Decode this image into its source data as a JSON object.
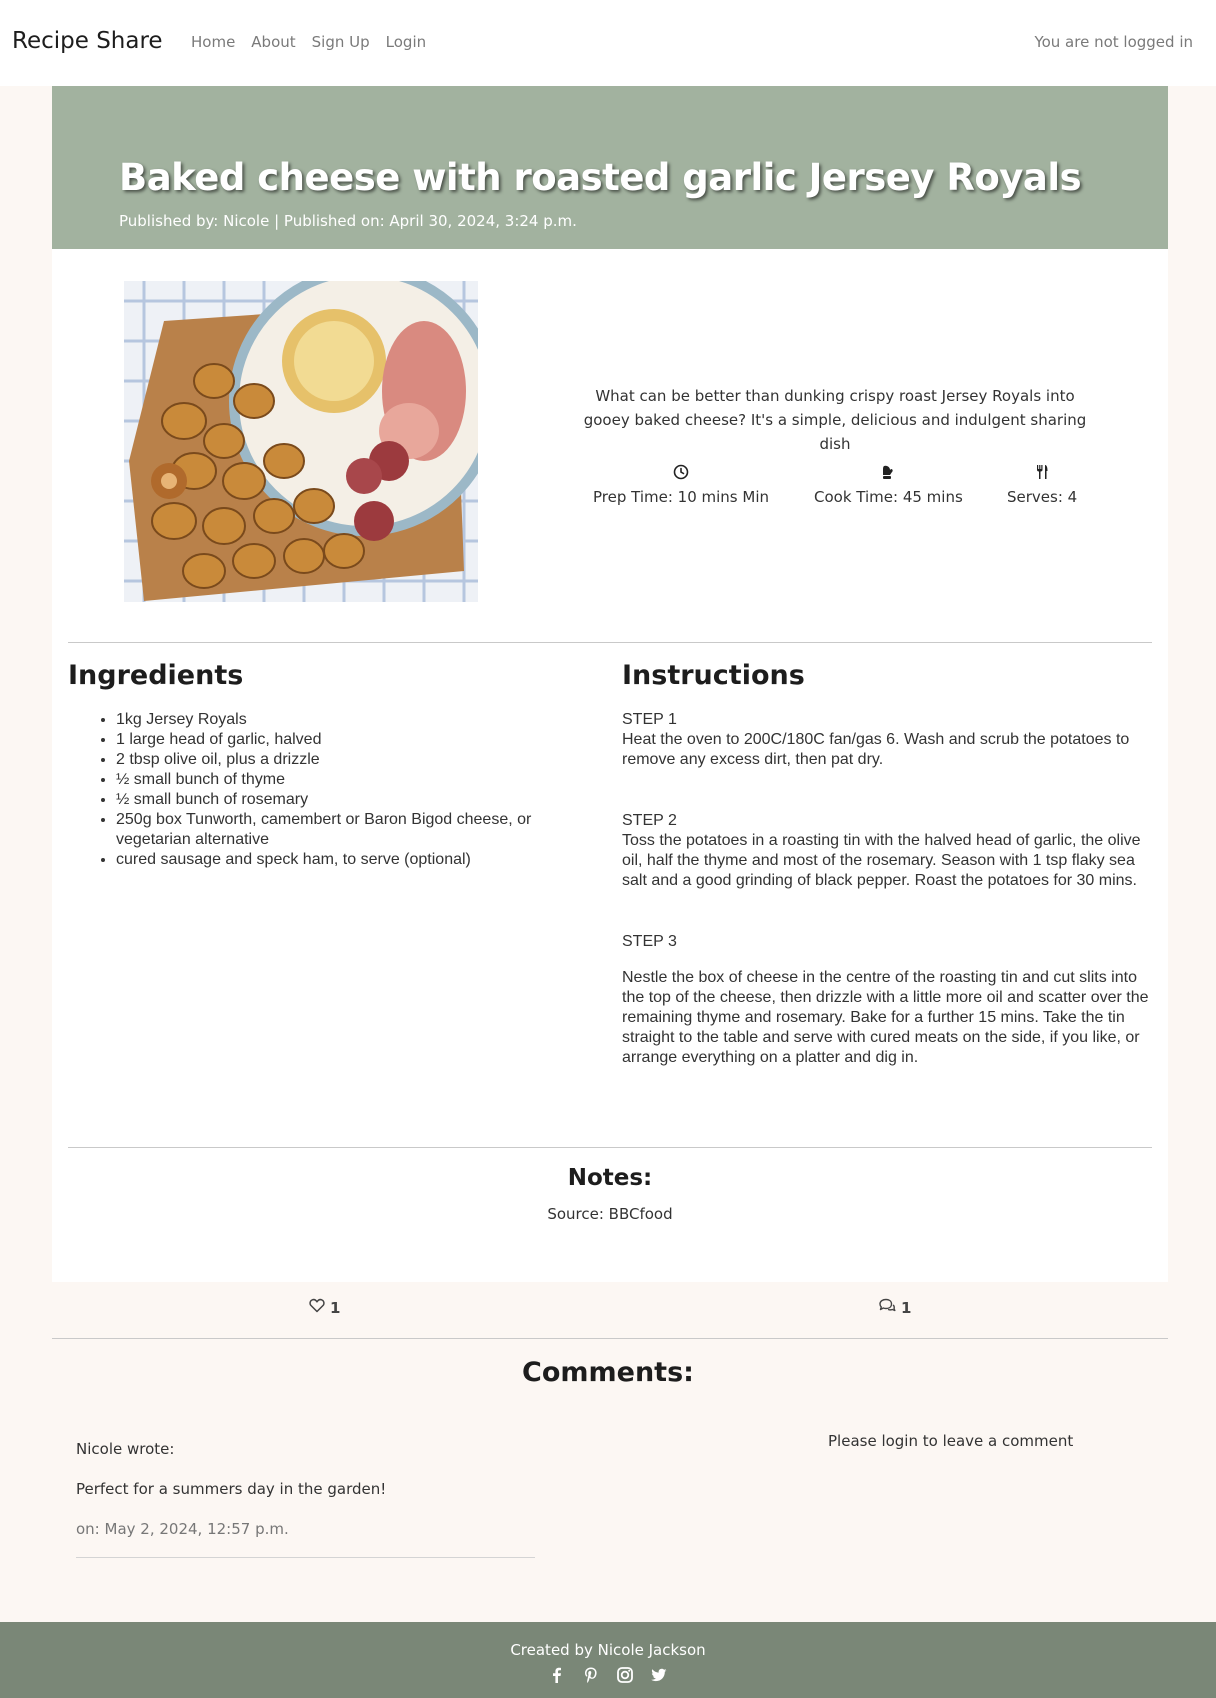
{
  "nav": {
    "brand": "Recipe Share",
    "links": [
      "Home",
      "About",
      "Sign Up",
      "Login"
    ],
    "status": "You are not logged in"
  },
  "hero": {
    "title": "Baked cheese with roasted garlic Jersey Royals",
    "meta": "Published by: Nicole | Published on: April 30, 2024, 3:24 p.m.",
    "background": "#a2b29f"
  },
  "recipe": {
    "image_alt": "Baked cheese with roasted potatoes, salami and ham on a board",
    "summary": "What can be better than dunking crispy roast Jersey Royals into gooey baked cheese? It's a simple, delicious and indulgent sharing dish",
    "stats": [
      {
        "icon": "clock-icon",
        "label": "Prep Time: 10 mins Min"
      },
      {
        "icon": "oven-mitt-icon",
        "label": "Cook Time: 45 mins"
      },
      {
        "icon": "utensils-icon",
        "label": "Serves: 4"
      }
    ]
  },
  "ingredients": {
    "title": "Ingredients",
    "items": [
      "1kg Jersey Royals",
      "1 large head of garlic, halved",
      "2 tbsp olive oil, plus a drizzle",
      "½ small bunch of thyme",
      "½ small bunch of rosemary",
      "250g box Tunworth, camembert or Baron Bigod cheese, or vegetarian alternative",
      "cured sausage and speck ham, to serve (optional)"
    ]
  },
  "instructions": {
    "title": "Instructions",
    "steps": [
      {
        "label": "STEP 1",
        "text": "Heat the oven to 200C/180C fan/gas 6. Wash and scrub the potatoes to remove any excess dirt, then pat dry."
      },
      {
        "label": "STEP 2",
        "text": "Toss the potatoes in a roasting tin with the halved head of garlic, the olive oil, half the thyme and most of the rosemary. Season with 1 tsp flaky sea salt and a good grinding of black pepper. Roast the potatoes for 30 mins."
      },
      {
        "label": "STEP 3",
        "text": "Nestle the box of cheese in the centre of the roasting tin and cut slits into the top of the cheese, then drizzle with a little more oil and scatter over the remaining thyme and rosemary. Bake for a further 15 mins. Take the tin straight to the table and serve with cured meats on the side, if you like, or arrange everything on a platter and dig in."
      }
    ]
  },
  "notes": {
    "title": "Notes:",
    "text": "Source: BBCfood"
  },
  "reactions": {
    "likes": "1",
    "comments": "1"
  },
  "comments": {
    "title": "Comments:",
    "items": [
      {
        "author": "Nicole wrote:",
        "body": "Perfect for a summers day in the garden!",
        "date": "on: May 2, 2024, 12:57 p.m."
      }
    ],
    "login_prompt": "Please login to leave a comment"
  },
  "footer": {
    "text": "Created by Nicole Jackson",
    "socials": [
      "facebook-icon",
      "pinterest-icon",
      "instagram-icon",
      "twitter-icon"
    ],
    "background": "#7a8777"
  }
}
